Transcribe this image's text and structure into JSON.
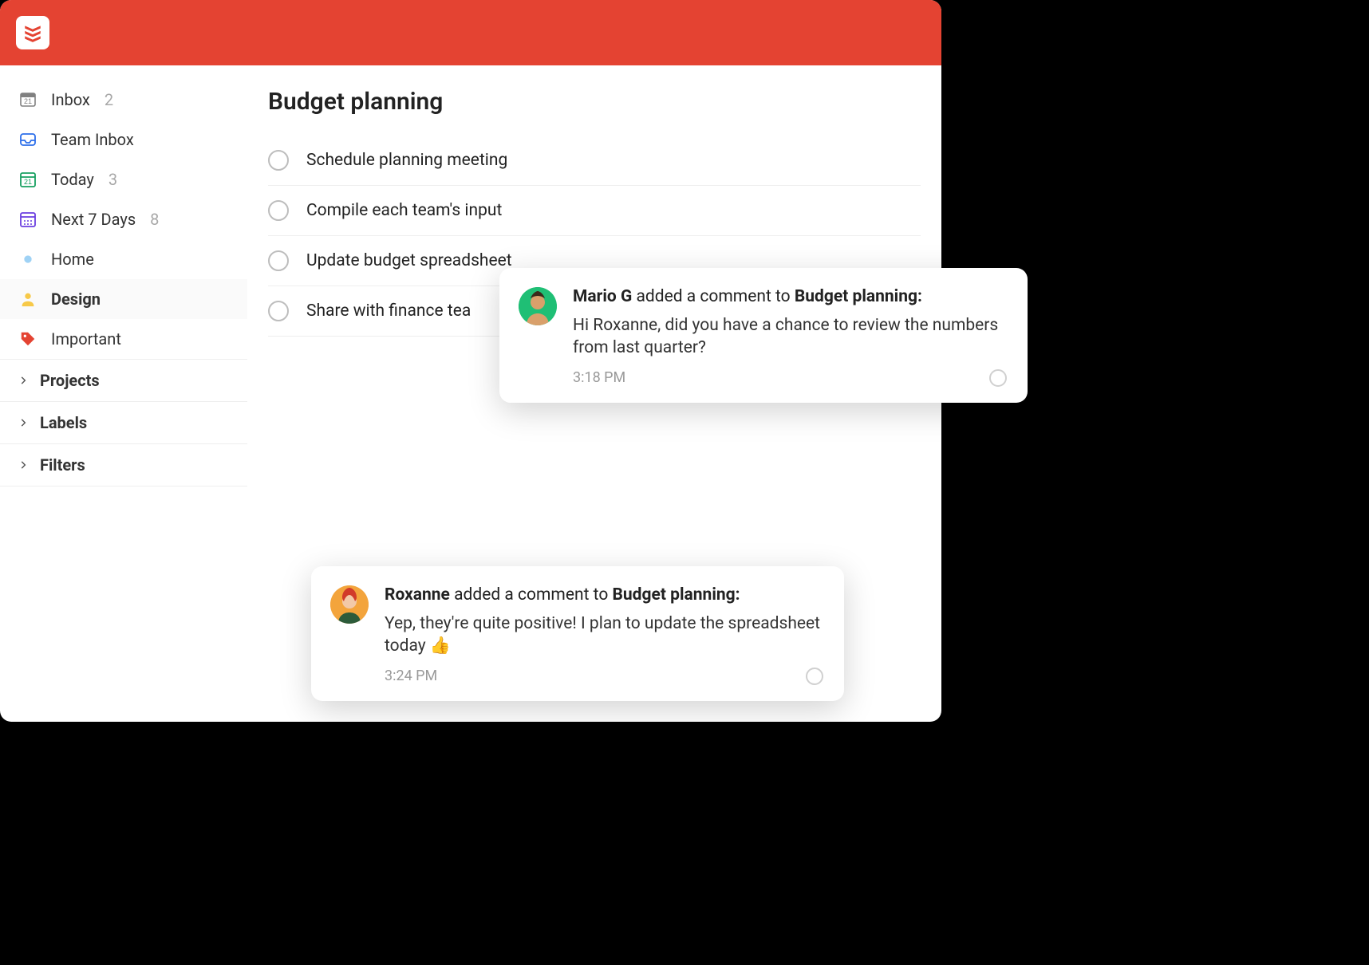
{
  "sidebar": {
    "items": [
      {
        "label": "Inbox",
        "count": "2"
      },
      {
        "label": "Team Inbox",
        "count": ""
      },
      {
        "label": "Today",
        "count": "3"
      },
      {
        "label": "Next 7 Days",
        "count": "8"
      },
      {
        "label": "Home",
        "count": ""
      },
      {
        "label": "Design",
        "count": ""
      },
      {
        "label": "Important",
        "count": ""
      }
    ],
    "groups": [
      {
        "label": "Projects"
      },
      {
        "label": "Labels"
      },
      {
        "label": "Filters"
      }
    ]
  },
  "main": {
    "title": "Budget planning",
    "tasks": [
      {
        "title": "Schedule planning meeting"
      },
      {
        "title": "Compile each team's input"
      },
      {
        "title": "Update budget spreadsheet"
      },
      {
        "title": "Share with finance tea"
      }
    ]
  },
  "notifications": [
    {
      "author": "Mario G",
      "action_mid": " added a comment to ",
      "target": "Budget planning:",
      "body": "Hi Roxanne, did you have a chance to review the numbers from last quarter?",
      "time": "3:18 PM"
    },
    {
      "author": "Roxanne",
      "action_mid": " added a comment to ",
      "target": "Budget planning:",
      "body": "Yep, they're quite positive! I plan to update the spreadsheet today 👍",
      "time": "3:24 PM"
    }
  ]
}
